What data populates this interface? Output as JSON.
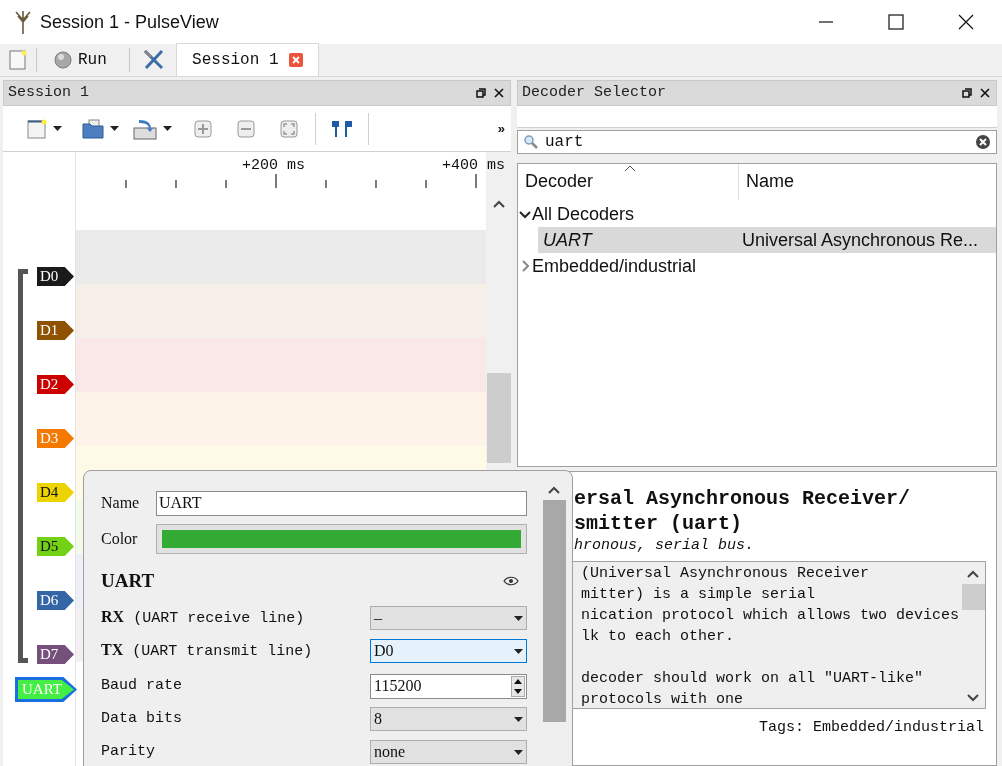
{
  "window": {
    "title": "Session 1 - PulseView"
  },
  "main_toolbar": {
    "run": "Run",
    "tabs": [
      {
        "label": "Session 1",
        "selected": true
      }
    ]
  },
  "session_dock": {
    "title": "Session 1",
    "overflow": "»",
    "ruler": [
      "+200 ms",
      "+400 ms"
    ],
    "channels": [
      {
        "label": "D0",
        "color": "#1a1a1a"
      },
      {
        "label": "D1",
        "color": "#8f5202"
      },
      {
        "label": "D2",
        "color": "#cc0000"
      },
      {
        "label": "D3",
        "color": "#f57900"
      },
      {
        "label": "D4",
        "color": "#edd400"
      },
      {
        "label": "D5",
        "color": "#73d216"
      },
      {
        "label": "D6",
        "color": "#3465a4"
      },
      {
        "label": "D7",
        "color": "#75507b"
      }
    ],
    "decoder_trace": {
      "label": "UART",
      "color": "#44ee44",
      "selected": true
    }
  },
  "decoder_dock": {
    "title": "Decoder Selector",
    "search": {
      "value": "uart"
    },
    "columns": [
      "Decoder",
      "Name"
    ],
    "tree": [
      {
        "label": "All Decoders",
        "expanded": true,
        "children": [
          {
            "id": "UART",
            "name": "Universal Asynchronous Re...",
            "selected": true
          }
        ]
      },
      {
        "label": "Embedded/industrial",
        "expanded": false
      }
    ],
    "description": {
      "title_lines": [
        "ersal Asynchronous Receiver/",
        "smitter (uart)"
      ],
      "subtitle": "hronous, serial bus.",
      "body_paragraphs": [
        [
          "(Universal Asynchronous Receiver",
          "mitter) is a simple serial",
          "nication protocol which allows two devices",
          "lk to each other."
        ],
        [
          "decoder should work on all \"UART-like\"",
          "protocols with one"
        ]
      ],
      "tags": "Tags: Embedded/industrial"
    }
  },
  "decoder_popup": {
    "name_label": "Name",
    "name_value": "UART",
    "color_label": "Color",
    "color": "#33aa33",
    "heading": "UART",
    "channels": [
      {
        "id": "RX",
        "desc": "(UART receive line)",
        "value": "–",
        "focused": false
      },
      {
        "id": "TX",
        "desc": "(UART transmit line)",
        "value": "D0",
        "focused": true
      }
    ],
    "options": [
      {
        "label": "Baud rate",
        "kind": "spin",
        "value": "115200"
      },
      {
        "label": "Data bits",
        "kind": "select",
        "value": "8"
      },
      {
        "label": "Parity",
        "kind": "select",
        "value": "none"
      }
    ]
  }
}
